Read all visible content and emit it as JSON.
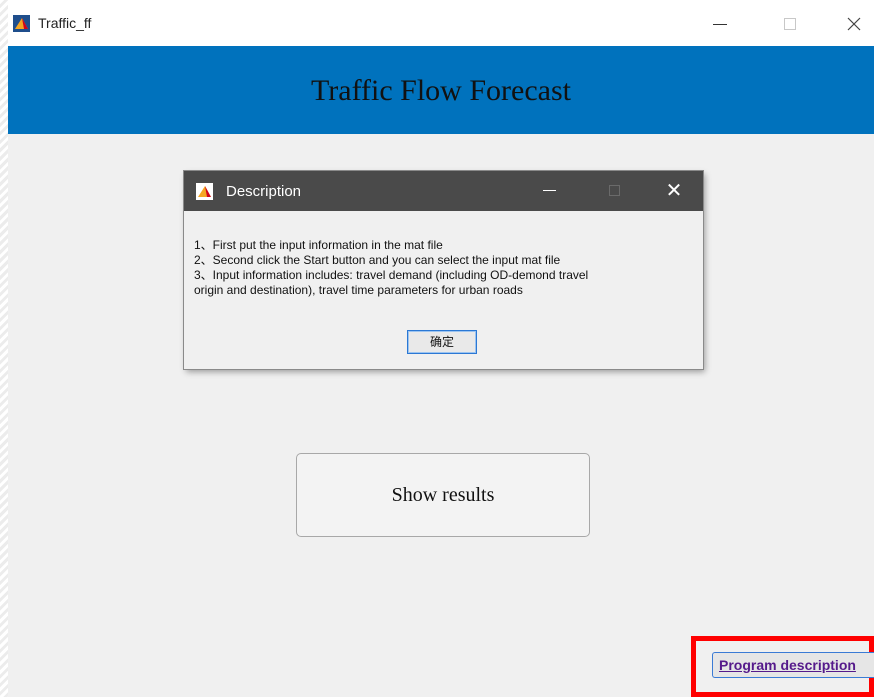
{
  "window": {
    "title": "Traffic_ff",
    "app_title": "Traffic Flow Forecast",
    "controls": [
      "minimize",
      "maximize",
      "close"
    ]
  },
  "dialog": {
    "title": "Description",
    "close_glyph": "✕",
    "lines": [
      "1、First put the input information in the mat file",
      "2、Second click the Start button and you can select the input mat file",
      "3、Input information includes: travel demand (including OD-demond travel",
      "origin and destination), travel time parameters for urban roads"
    ],
    "ok_label": "确定"
  },
  "main": {
    "show_results_label": "Show results",
    "program_description_label": "Program description"
  },
  "colors": {
    "header_band": "#0072bd",
    "dialog_titlebar": "#4a4a4a",
    "highlight": "#ff0000",
    "link_text": "#551a8b"
  },
  "icons": {
    "app": "matlab-icon",
    "dialog": "matlab-icon"
  }
}
